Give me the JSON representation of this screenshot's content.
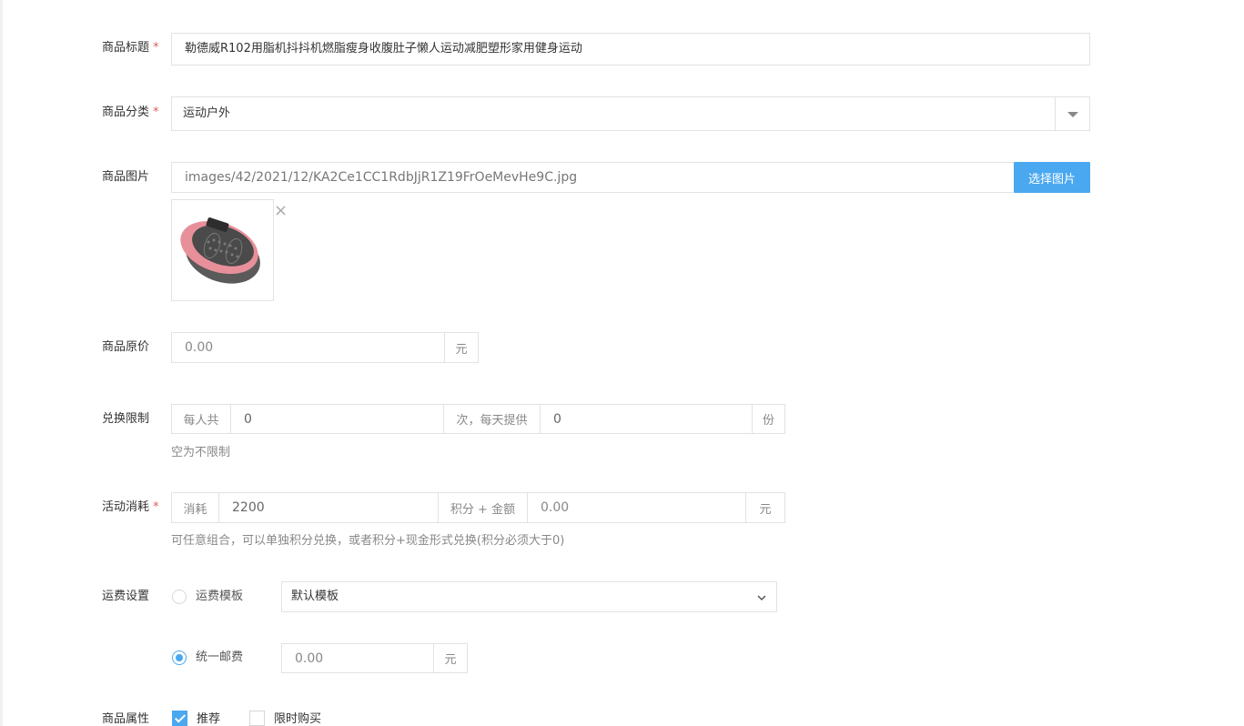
{
  "title_field": {
    "label": "商品标题",
    "required_mark": "*",
    "value": "勒德威R102用脂机抖抖机燃脂瘦身收腹肚子懒人运动减肥塑形家用健身运动"
  },
  "category_field": {
    "label": "商品分类",
    "required_mark": "*",
    "value": "运动户外"
  },
  "image_field": {
    "label": "商品图片",
    "path_value": "images/42/2021/12/KA2Ce1CC1RdbJjR1Z19FrOeMevHe9C.jpg",
    "select_button": "选择图片",
    "remove_symbol": "×"
  },
  "original_price_field": {
    "label": "商品原价",
    "placeholder": "0.00",
    "unit": "元"
  },
  "exchange_limit_field": {
    "label": "兑换限制",
    "prefix": "每人共",
    "per_person_value": "0",
    "middle": "次，每天提供",
    "per_day_value": "0",
    "unit": "份",
    "hint": "空为不限制"
  },
  "activity_cost_field": {
    "label": "活动消耗",
    "required_mark": "*",
    "prefix": "消耗",
    "points_value": "2200",
    "middle": "积分 + 金额",
    "money_placeholder": "0.00",
    "unit": "元",
    "hint": "可任意组合，可以单独积分兑换，或者积分+现金形式兑换(积分必须大于0)"
  },
  "shipping_field": {
    "label": "运费设置",
    "template_option_label": "运费模板",
    "template_selected": "默认模板",
    "unified_option_label": "统一邮费",
    "unified_placeholder": "0.00",
    "unit": "元",
    "selected": "unified"
  },
  "attributes_field": {
    "label": "商品属性",
    "options": [
      {
        "label": "推荐",
        "checked": true
      },
      {
        "label": "限时购买",
        "checked": false
      }
    ]
  },
  "colors": {
    "primary": "#4aa8f0",
    "required": "#e05a5a",
    "border": "#e2e2e2"
  }
}
